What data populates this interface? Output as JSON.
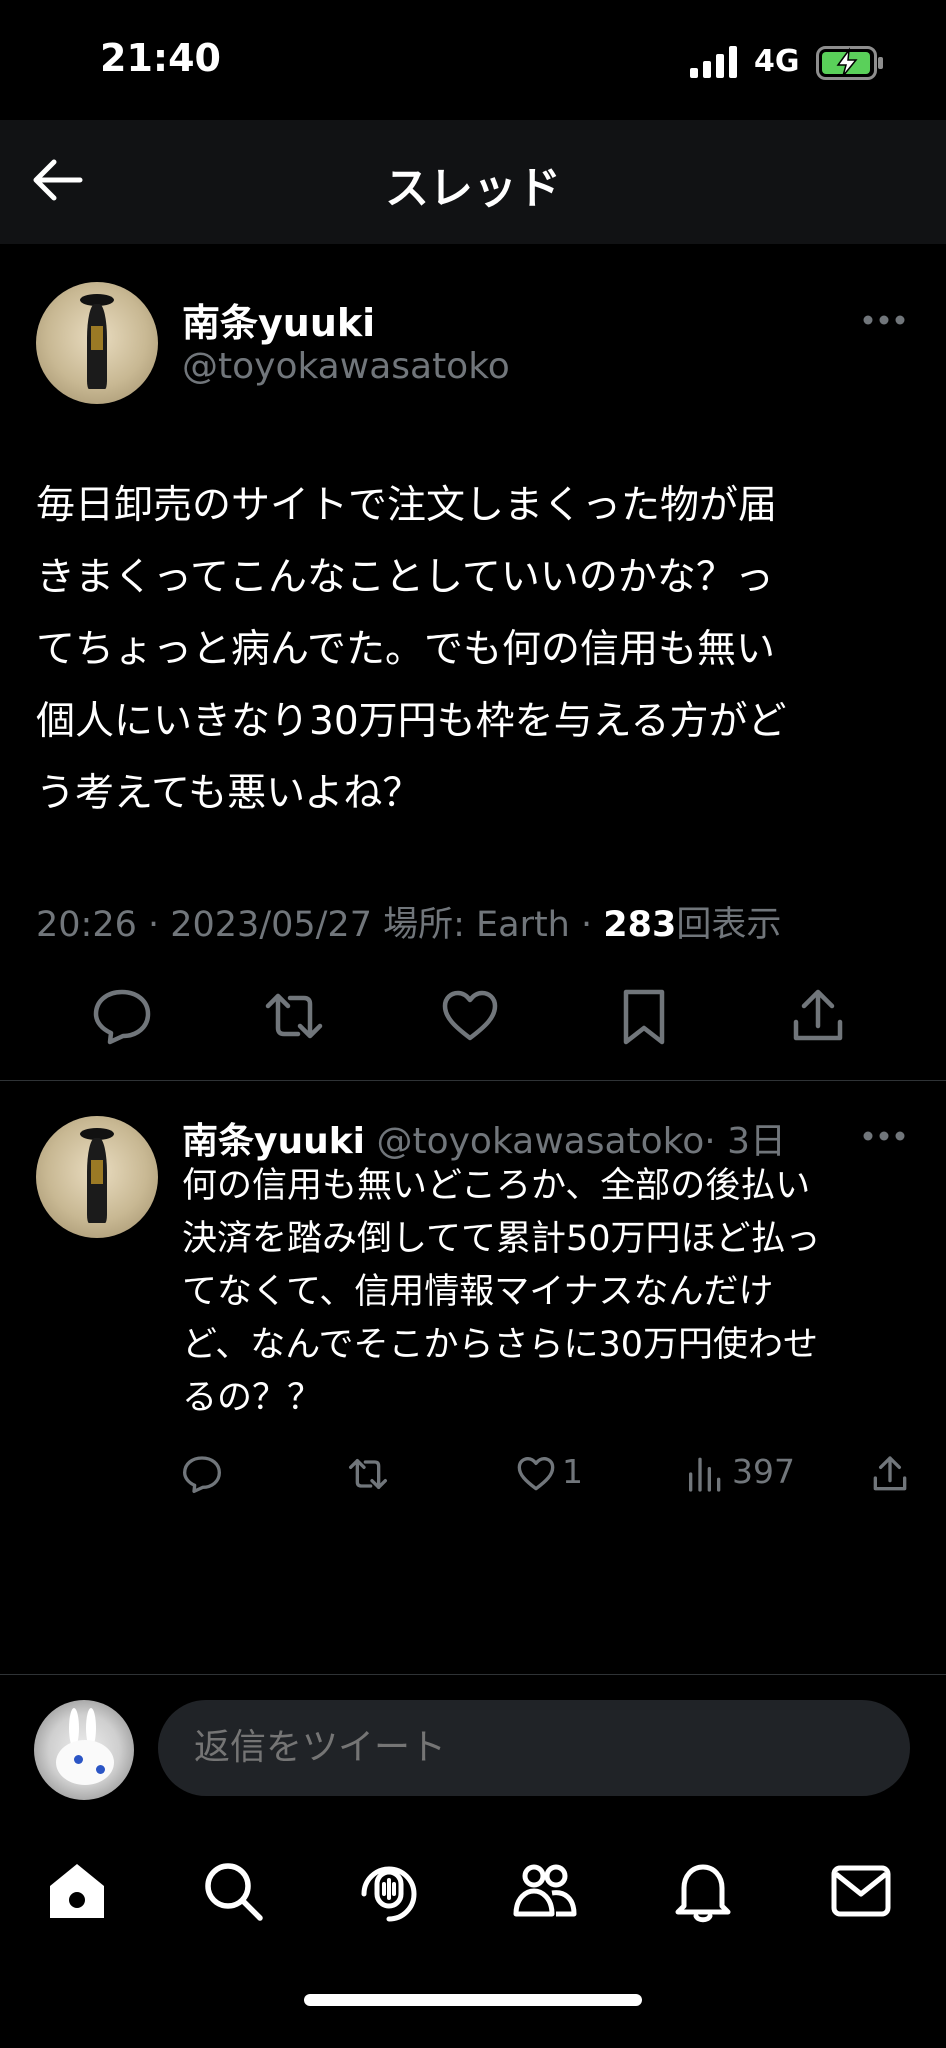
{
  "status_bar": {
    "time": "21:40",
    "network": "4G"
  },
  "header": {
    "title": "スレッド"
  },
  "main_tweet": {
    "name": "南条yuuki",
    "handle": "@toyokawasatoko",
    "text": "毎日卸売のサイトで注文しまくった物が届\nきまくってこんなことしていいのかな？っ\nてちょっと病んでた。でも何の信用も無い\n個人にいきなり30万円も枠を与える方がど\nう考えても悪いよね？",
    "meta_prefix": "20:26 · 2023/05/27 場所: Earth · ",
    "views_count": "283",
    "views_label": "回表示"
  },
  "reply": {
    "name": "南条yuuki",
    "handle": "@toyokawasatoko",
    "time_ago": "· 3日",
    "text": "何の信用も無いどころか、全部の後払い\n決済を踏み倒してて累計50万円ほど払っ\nてなくて、信用情報マイナスなんだけ\nど、なんでそこからさらに30万円使わせ\nるの？？",
    "like_count": "1",
    "view_count": "397"
  },
  "composer": {
    "placeholder": "返信をツイート"
  },
  "colors": {
    "background": "#000000",
    "muted": "#71767b",
    "text": "#e7e9ea",
    "input_bg": "#202327"
  },
  "icons": [
    "arrow-left-icon",
    "more-icon",
    "reply-icon",
    "retweet-icon",
    "like-icon",
    "bookmark-icon",
    "share-icon",
    "views-icon",
    "home-icon",
    "search-icon",
    "spaces-icon",
    "communities-icon",
    "notifications-icon",
    "messages-icon"
  ]
}
